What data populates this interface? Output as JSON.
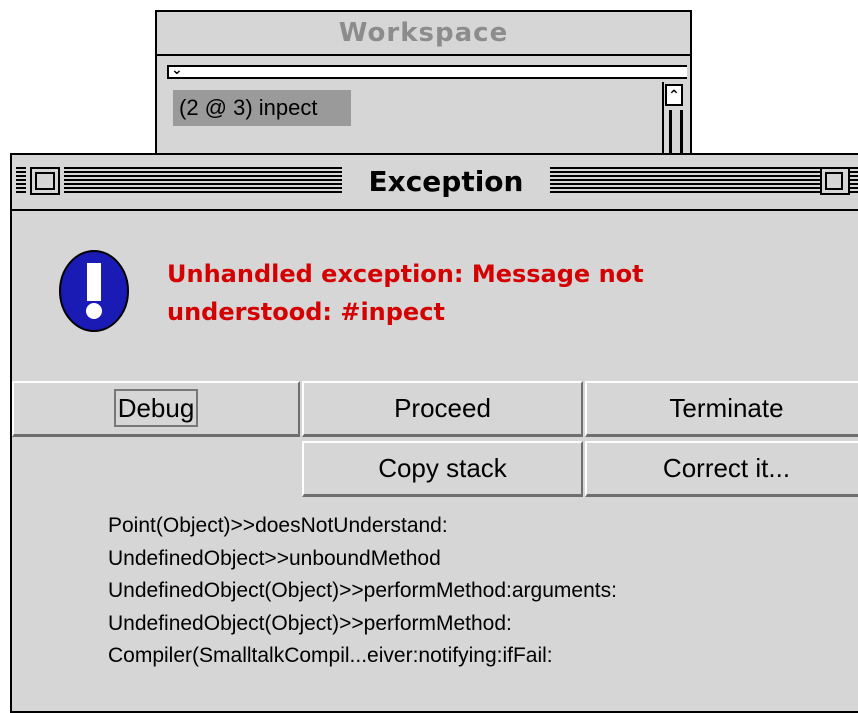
{
  "workspace": {
    "title": "Workspace",
    "code_text": "(2 @ 3) inpect",
    "menu_glyph": "⌄",
    "scroll_up_glyph": "⌃"
  },
  "exception": {
    "title": "Exception",
    "message_line1": "Unhandled exception: Message not",
    "message_line2": "understood: #inpect",
    "buttons": {
      "debug": "Debug",
      "proceed": "Proceed",
      "terminate": "Terminate",
      "copy_stack": "Copy stack",
      "correct_it": "Correct it..."
    },
    "stack": [
      "Point(Object)>>doesNotUnderstand:",
      "UndefinedObject>>unboundMethod",
      "UndefinedObject(Object)>>performMethod:arguments:",
      "UndefinedObject(Object)>>performMethod:",
      "Compiler(SmalltalkCompil...eiver:notifying:ifFail:"
    ]
  },
  "colors": {
    "window_bg": "#d6d6d6",
    "message_red": "#d40000",
    "icon_blue": "#1a1ab4"
  },
  "icons": {
    "alert": "exclamation-alert-icon",
    "close": "close-box-icon",
    "zoom": "zoom-box-icon"
  }
}
